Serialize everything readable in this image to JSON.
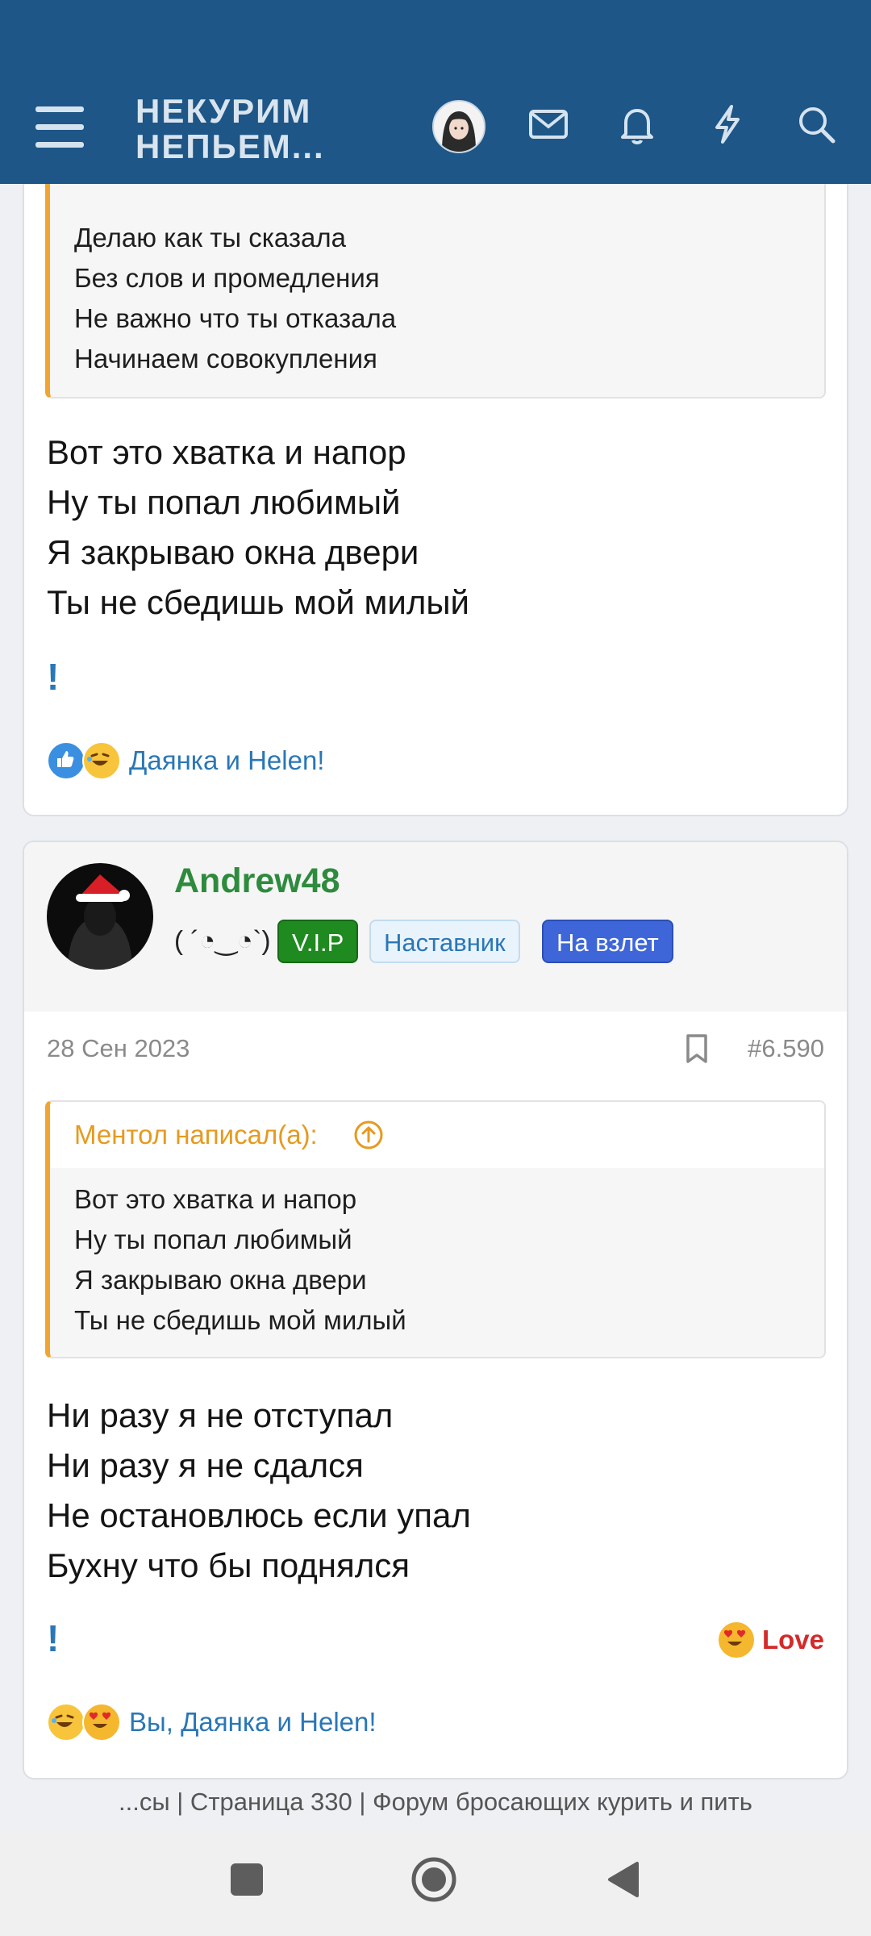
{
  "header": {
    "logo_line1": "НЕКУРИМ",
    "logo_line2": "НЕПЬЕМ...",
    "icons": [
      "menu-icon",
      "avatar",
      "mail-icon",
      "bell-icon",
      "lightning-icon",
      "search-icon"
    ]
  },
  "post1": {
    "quote_lines": [
      "Делаю как ты сказала",
      "Без слов и промедления",
      "Не важно что ты отказала",
      "Начинаем совокупления"
    ],
    "message_lines": [
      "Вот это хватка и напор",
      "Ну ты попал любимый",
      "Я закрываю окна двери",
      "Ты не сбедишь мой милый"
    ],
    "bang": "!",
    "reactions_text": "Даянка и Helen!",
    "reaction_icons": [
      "like-icon",
      "laughing-icon"
    ]
  },
  "post2": {
    "username": "Andrew48",
    "user_title": "( ´◔‿◔`)",
    "badges": [
      "V.I.P",
      "Наставник",
      "На взлет"
    ],
    "date": "28 Сен 2023",
    "post_number": "#6.590",
    "quote_author": "Ментол написал(а):",
    "quote_lines": [
      "Вот это хватка и напор",
      "Ну ты попал любимый",
      "Я закрываю окна двери",
      "Ты не сбедишь мой милый"
    ],
    "message_lines": [
      "Ни разу я не отступал",
      "Ни разу я не сдался",
      "Не остановлюсь если упал",
      "Бухну что бы поднялся"
    ],
    "bang": "!",
    "reaction_label": "Love",
    "reactions_text": "Вы, Даянка и Helen!",
    "reaction_icons": [
      "laughing-icon",
      "heart-eyes-icon"
    ]
  },
  "footer": {
    "page_title": "...сы | Страница 330 | Форум бросающих курить и пить"
  },
  "colors": {
    "header_bg": "#1d5687",
    "link": "#2a77b6",
    "quote_accent": "#f0a532",
    "username": "#2e8b3e",
    "love": "#d42a2a"
  }
}
